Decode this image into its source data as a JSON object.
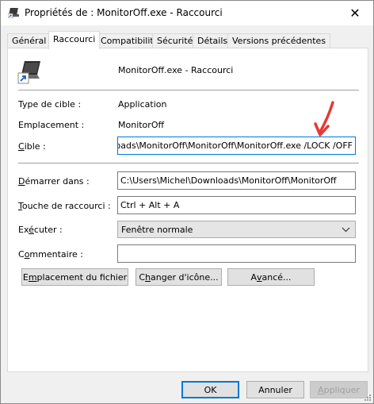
{
  "window": {
    "title": "Propriétés de : MonitorOff.exe - Raccourci",
    "close_glyph": "✕"
  },
  "tabs": [
    {
      "label": "Général"
    },
    {
      "label": "Raccourci"
    },
    {
      "label": "Compatibilité"
    },
    {
      "label": "Sécurité"
    },
    {
      "label": "Détails"
    },
    {
      "label": "Versions précédentes"
    }
  ],
  "header": {
    "name": "MonitorOff.exe - Raccourci"
  },
  "info": {
    "type_label": "Type de cible :",
    "type_value": "Application",
    "location_label": "Emplacement :",
    "location_value": "MonitorOff"
  },
  "fields": {
    "target_label_key": "C",
    "target_label_rest": "ible :",
    "target_value": "C:\\Users\\Michel\\Downloads\\MonitorOff\\MonitorOff\\MonitorOff.exe /LOCK /OFF",
    "start_label_key": "D",
    "start_label_rest": "émarrer dans :",
    "start_value": "C:\\Users\\Michel\\Downloads\\MonitorOff\\MonitorOff",
    "shortcut_label_key": "T",
    "shortcut_label_rest": "ouche de raccourci :",
    "shortcut_value": "Ctrl + Alt + A",
    "run_label_pre": "Ex",
    "run_label_key": "é",
    "run_label_rest": "cuter :",
    "run_value": "Fenêtre normale",
    "comment_label_pre": "C",
    "comment_label_key": "o",
    "comment_label_rest": "mmentaire :",
    "comment_value": ""
  },
  "actions": {
    "open_location_pre": "E",
    "open_location_key": "m",
    "open_location_rest": "placement du fichier",
    "change_icon_pre": "C",
    "change_icon_key": "h",
    "change_icon_rest": "anger d'icône...",
    "advanced_pre": "A",
    "advanced_key": "v",
    "advanced_rest": "ancé..."
  },
  "footer": {
    "ok": "OK",
    "cancel": "Annuler",
    "apply_key": "A",
    "apply_rest": "ppliquer"
  },
  "colors": {
    "focus": "#0078d7",
    "annotation_arrow": "#e53935"
  },
  "icons": [
    "shortcut-app-icon",
    "close-icon",
    "chevron-down-icon",
    "annotation-arrow",
    "resize-grip-icon"
  ]
}
